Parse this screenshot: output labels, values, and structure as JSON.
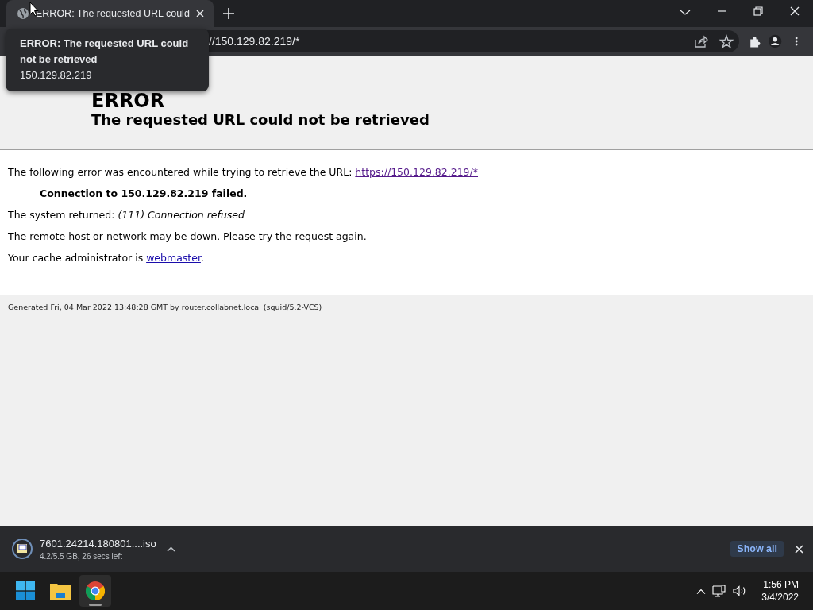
{
  "browser": {
    "tab": {
      "title": "ERROR: The requested URL could",
      "selected": true
    },
    "tooltip": {
      "title": "ERROR: The requested URL could not be retrieved",
      "host": "150.129.82.219"
    },
    "address": "//150.129.82.219/*"
  },
  "page": {
    "heading": "ERROR",
    "subheading": "The requested URL could not be retrieved",
    "intro": "The following error was encountered while trying to retrieve the URL:",
    "url_link": "https://150.129.82.219/*",
    "failure": "Connection to 150.129.82.219 failed.",
    "system_returned": "The system returned: *(111) Connection refused*",
    "hint": "The remote host or network may be down. Please try the request again.",
    "admin": "Your cache administrator is",
    "admin_link": "webmaster",
    "admin_end": ".",
    "footer": "Generated Fri, 04 Mar 2022 13:48:28 GMT by router.collabnet.local (squid/5.2-VCS)"
  },
  "download": {
    "file": "7601.24214.180801....iso",
    "status": "4.2/5.5 GB, 26 secs left",
    "show_all": "Show all"
  },
  "taskbar": {
    "apps": [
      {
        "kind": "start",
        "selected": false
      },
      {
        "kind": "explorer",
        "selected": false
      },
      {
        "kind": "chrome",
        "selected": true
      }
    ],
    "time": "1:56 PM",
    "date": "3/4/2022"
  }
}
